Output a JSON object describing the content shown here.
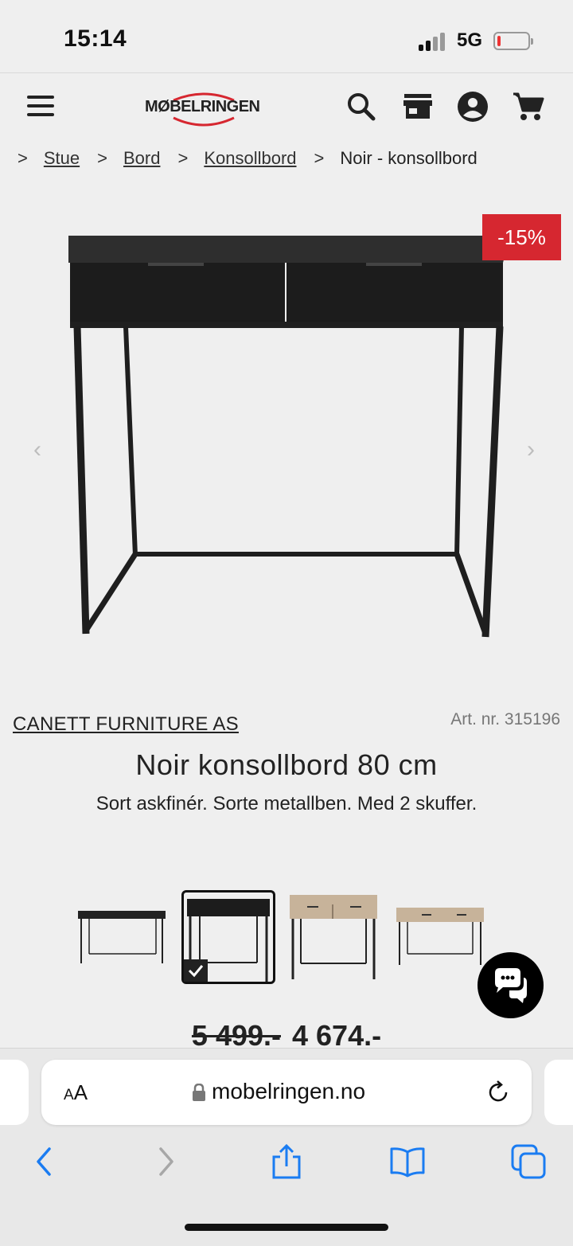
{
  "status_bar": {
    "time": "15:14",
    "network": "5G"
  },
  "header": {
    "logo_text": "MØBELRINGEN",
    "icons": [
      "menu-icon",
      "search-icon",
      "store-icon",
      "account-icon",
      "cart-icon"
    ]
  },
  "breadcrumb": {
    "separator": ">",
    "links": [
      "Stue",
      "Bord",
      "Konsollbord"
    ],
    "current": "Noir - konsollbord"
  },
  "product": {
    "discount_badge": "-15%",
    "brand": "CANETT FURNITURE AS",
    "article_number": "Art. nr. 315196",
    "title": "Noir konsollbord 80 cm",
    "subtitle": "Sort askfinér. Sorte metallben. Med 2 skuffer.",
    "old_price": "5 499.-",
    "price": "4 674.-",
    "variants": [
      {
        "style": "black",
        "selected": false
      },
      {
        "style": "black",
        "selected": true
      },
      {
        "style": "oak",
        "selected": false
      },
      {
        "style": "oak",
        "selected": false
      }
    ]
  },
  "browser": {
    "text_size_label": "AA",
    "url": "mobelringen.no",
    "toolbar": [
      "back-icon",
      "forward-icon",
      "share-icon",
      "bookmarks-icon",
      "tabs-icon"
    ]
  },
  "colors": {
    "sale_red": "#d62730",
    "background": "#efefef"
  }
}
